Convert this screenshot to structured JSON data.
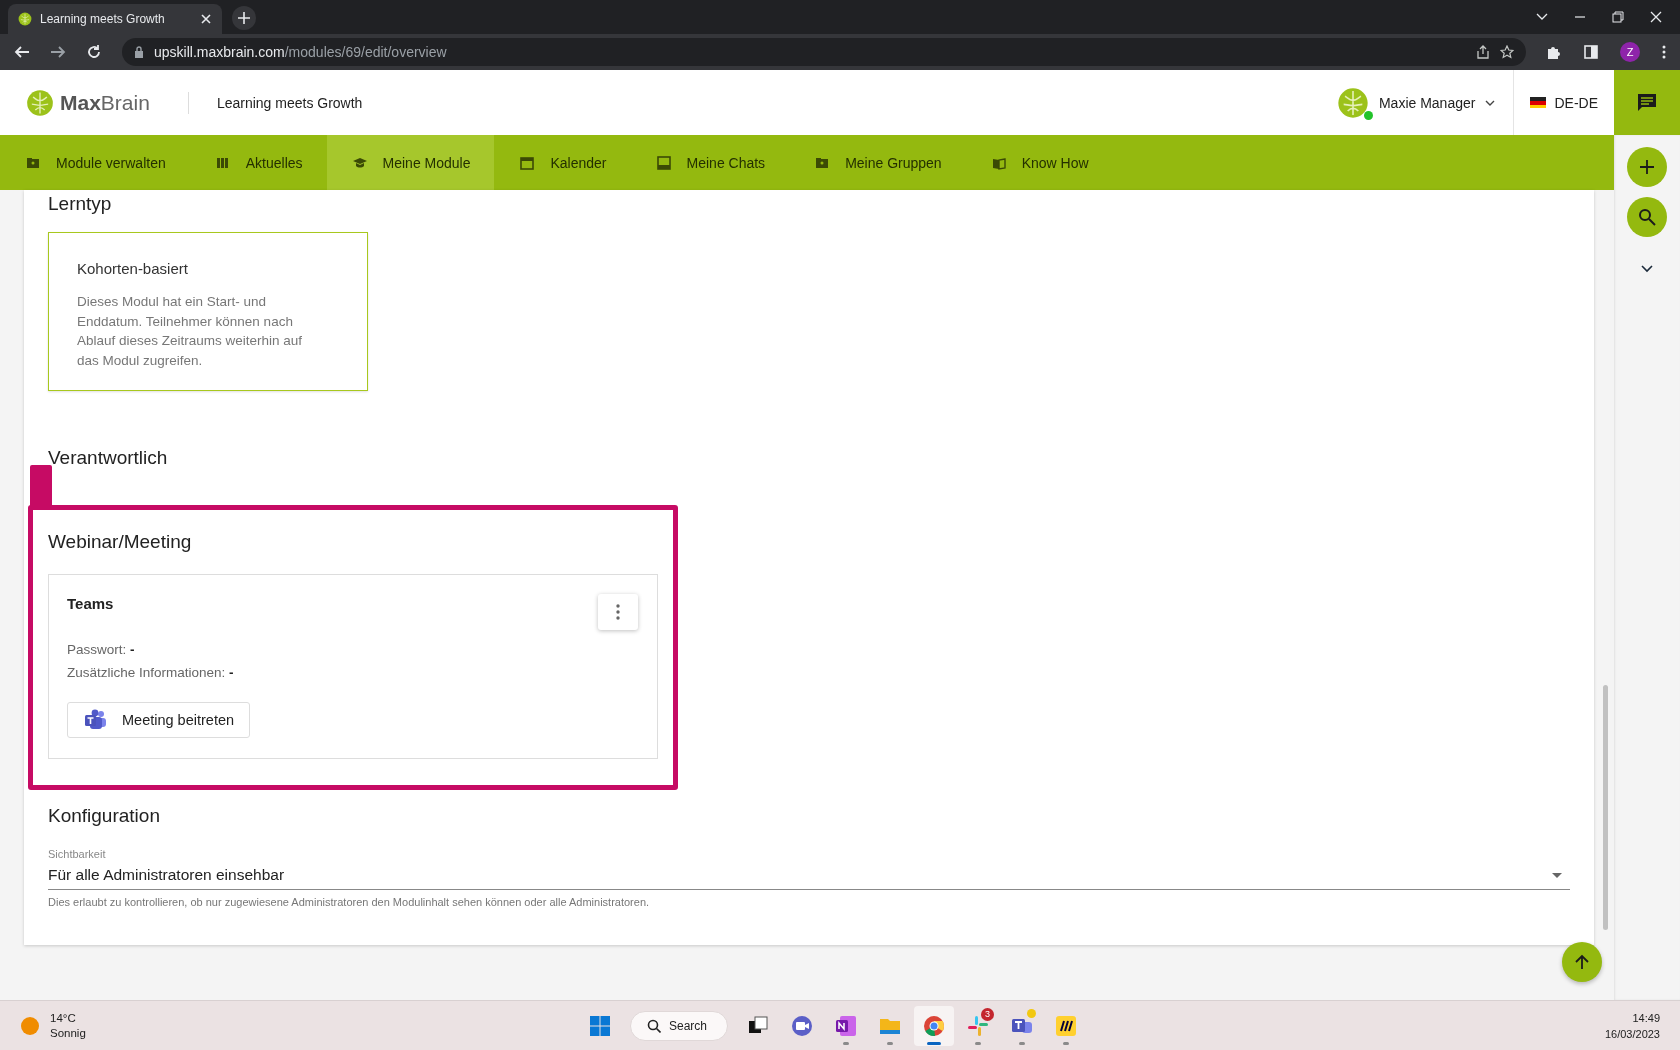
{
  "browser": {
    "tabs": [
      {
        "title": "Learning meets Growth",
        "selected": true
      }
    ],
    "url_host": "upskill.maxbrain.com",
    "url_path": "/modules/69/edit/overview",
    "profile_initial": "Z"
  },
  "header": {
    "logo": "**Max**Brain",
    "tagline": "Learning meets Growth",
    "user_name": "Maxie Manager",
    "user_online": true,
    "language": "DE-DE"
  },
  "nav": [
    {
      "label": "Module verwalten",
      "selected": false
    },
    {
      "label": "Aktuelles",
      "selected": false
    },
    {
      "label": "Meine Module",
      "selected": true
    },
    {
      "label": "Kalender",
      "selected": false
    },
    {
      "label": "Meine Chats",
      "selected": false
    },
    {
      "label": "Meine Gruppen",
      "selected": false
    },
    {
      "label": "Know How",
      "selected": false
    }
  ],
  "lerntyp": {
    "heading": "Lerntyp",
    "option_title": "Kohorten-basiert",
    "option_text": "Dieses Modul hat ein Start- und Enddatum. Teilnehmer können nach Ablauf dieses Zeitraums weiterhin auf das Modul zugreifen.",
    "selected": true
  },
  "verantwortlich": {
    "heading": "Verantwortlich"
  },
  "webinar": {
    "heading": "Webinar/Meeting",
    "highlighted": true,
    "card": {
      "title": "Teams",
      "password": "Passwort: **-**",
      "info": "Zusätzliche Informationen: **-**",
      "join_button": "Meeting beitreten"
    }
  },
  "konfiguration": {
    "heading": "Konfiguration",
    "field_label": "Sichtbarkeit",
    "value": "Für alle Administratoren einsehbar",
    "hint": "Dies erlaubt zu kontrollieren, ob nur zugewiesene Administratoren den Modulinhalt sehen können oder alle Administratoren."
  },
  "taskbar": {
    "temperature": "14°C",
    "weather": "Sonnig",
    "apps": [
      {
        "kind": "start",
        "running": false,
        "selected": false,
        "alert": false
      },
      {
        "kind": "search",
        "label": "Search",
        "running": false,
        "selected": false,
        "alert": false
      },
      {
        "kind": "taskview",
        "running": false,
        "selected": false,
        "alert": false
      },
      {
        "kind": "meet",
        "running": false,
        "selected": false,
        "alert": false
      },
      {
        "kind": "onenote",
        "running": true,
        "selected": false,
        "alert": false
      },
      {
        "kind": "explorer",
        "running": true,
        "selected": false,
        "alert": false
      },
      {
        "kind": "chrome",
        "running": true,
        "selected": true,
        "alert": false
      },
      {
        "kind": "slack",
        "running": true,
        "selected": false,
        "alert": false,
        "badge": "3"
      },
      {
        "kind": "teams",
        "running": true,
        "selected": false,
        "alert": true
      },
      {
        "kind": "miro",
        "running": true,
        "selected": false,
        "alert": false
      }
    ],
    "time": "14:49",
    "date": "16/03/2023"
  }
}
